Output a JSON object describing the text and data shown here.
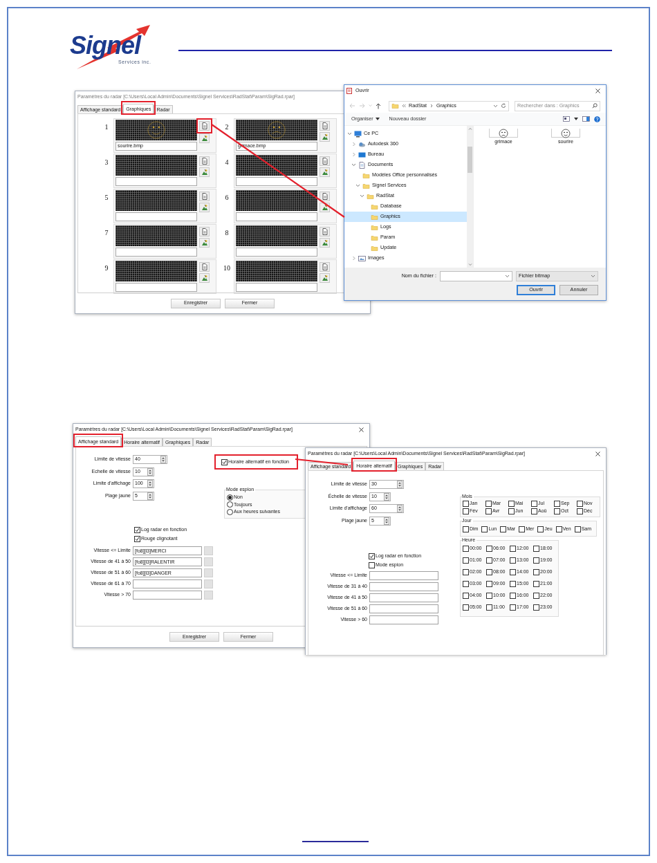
{
  "header": {
    "logo_name": "Signel",
    "logo_tagline": "Services inc."
  },
  "graphics_dialog": {
    "title": "Paramètres du radar [C:\\Users\\Local Admin\\Documents\\Signel Services\\RadStat\\Param\\SigRad.rpar]",
    "tabs": [
      {
        "label": "Affichage standard",
        "selected": false,
        "highlighted": false
      },
      {
        "label": "Graphiques",
        "selected": true,
        "highlighted": true
      },
      {
        "label": "Radar",
        "selected": false,
        "highlighted": false
      }
    ],
    "slots": [
      {
        "number": "1",
        "file": "sourire.bmp",
        "kind": "smile",
        "load_highlighted": true
      },
      {
        "number": "2",
        "file": "grimace.bmp",
        "kind": "grimace",
        "load_highlighted": false
      },
      {
        "number": "3",
        "kind": "empty",
        "load_highlighted": false
      },
      {
        "number": "4",
        "kind": "empty",
        "load_highlighted": false
      },
      {
        "number": "5",
        "kind": "empty",
        "load_highlighted": false
      },
      {
        "number": "6",
        "kind": "empty",
        "load_highlighted": false
      },
      {
        "number": "7",
        "kind": "empty",
        "load_highlighted": false
      },
      {
        "number": "8",
        "kind": "empty",
        "load_highlighted": false
      },
      {
        "number": "9",
        "kind": "empty",
        "load_highlighted": false
      },
      {
        "number": "10",
        "kind": "empty",
        "load_highlighted": false
      }
    ],
    "buttons": [
      "Enregistrer",
      "Fermer"
    ]
  },
  "open_dialog": {
    "title": "Ouvrir",
    "path": [
      "RadStat",
      "Graphics"
    ],
    "search_placeholder": "Rechercher dans : Graphics",
    "toolbar": [
      {
        "label": "Organiser",
        "kind": "menu"
      },
      {
        "label": "Nouveau dossier",
        "kind": "button"
      }
    ],
    "tree": [
      {
        "label": "Ce PC",
        "kind": "computer",
        "expanded": true,
        "selected": false,
        "children": [
          {
            "label": "Autodesk 360",
            "kind": "cloud",
            "expanded": false,
            "selected": false
          },
          {
            "label": "Bureau",
            "kind": "desktop",
            "expanded": false,
            "selected": false
          },
          {
            "label": "Documents",
            "kind": "documents",
            "expanded": true,
            "selected": false,
            "children": [
              {
                "label": "Modèles Office personnalisés",
                "kind": "folder",
                "selected": false
              },
              {
                "label": "Signel Services",
                "kind": "folder",
                "expanded": true,
                "selected": false,
                "children": [
                  {
                    "label": "RadStat",
                    "kind": "folder",
                    "expanded": true,
                    "selected": false,
                    "children": [
                      {
                        "label": "Database",
                        "kind": "folder",
                        "selected": false
                      },
                      {
                        "label": "Graphics",
                        "kind": "folder",
                        "selected": true
                      },
                      {
                        "label": "Logs",
                        "kind": "folder",
                        "selected": false
                      },
                      {
                        "label": "Param",
                        "kind": "folder",
                        "selected": false
                      },
                      {
                        "label": "Update",
                        "kind": "folder",
                        "selected": false
                      }
                    ]
                  }
                ]
              }
            ]
          },
          {
            "label": "Images",
            "kind": "images",
            "expanded": false,
            "selected": false
          }
        ]
      }
    ],
    "files": [
      {
        "name": "grimace",
        "kind": "frown"
      },
      {
        "name": "sourire",
        "kind": "smile"
      }
    ],
    "filename_label": "Nom du fichier :",
    "filetype": "Fichier bitmap",
    "buttons": [
      {
        "label": "Ouvrir",
        "default": true
      },
      {
        "label": "Annuler",
        "default": false
      }
    ]
  },
  "standard_dialog": {
    "title": "Paramètres du radar [C:\\Users\\Local Admin\\Documents\\Signel Services\\RadStat\\Param\\SigRad.rpar]",
    "tabs": [
      {
        "label": "Affichage standard",
        "selected": true,
        "highlighted": true
      },
      {
        "label": "Horaire alternatif",
        "selected": false,
        "highlighted": false
      },
      {
        "label": "Graphiques",
        "selected": false,
        "highlighted": false
      },
      {
        "label": "Radar",
        "selected": false,
        "highlighted": false
      }
    ],
    "spinners": [
      {
        "label": "Limite de vitesse",
        "value": "40"
      },
      {
        "label": "Echelle de vitesse",
        "value": "10"
      },
      {
        "label": "Limite d'affichage",
        "value": "100"
      },
      {
        "label": "Plage jaune",
        "value": "5"
      }
    ],
    "alternate_schedule": {
      "label": "Horaire alternatif en fonction",
      "checked": true,
      "highlighted": true
    },
    "spy_mode": {
      "title": "Mode espion",
      "options": [
        {
          "label": "Non",
          "selected": true
        },
        {
          "label": "Toujours",
          "selected": false
        },
        {
          "label": "Aux heures suivantes",
          "selected": false
        }
      ]
    },
    "options": [
      {
        "label": "Log radar en fonction",
        "checked": true
      },
      {
        "label": "Rouge clignotant",
        "checked": true
      }
    ],
    "messages": [
      {
        "label": "Vitesse <= Limite",
        "value": "[fo8][l3]MERCI"
      },
      {
        "label": "Vitesse de 41 à 50",
        "value": "[fo8][l3]RALENTIR"
      },
      {
        "label": "Vitesse de 51 à 60",
        "value": "[fo8][l3]DANGER"
      },
      {
        "label": "Vitesse de 61 à 70"
      },
      {
        "label": "Vitesse > 70"
      }
    ],
    "buttons": [
      "Enregistrer",
      "Fermer"
    ]
  },
  "alternate_dialog": {
    "title": "Paramètres du radar [C:\\Users\\Local Admin\\Documents\\Signel Services\\RadStat\\Param\\SigRad.rpar]",
    "tabs": [
      {
        "label": "Affichage standard",
        "selected": false,
        "highlighted": false
      },
      {
        "label": "Horaire alternatif",
        "selected": true,
        "highlighted": true
      },
      {
        "label": "Graphiques",
        "selected": false,
        "highlighted": false
      },
      {
        "label": "Radar",
        "selected": false,
        "highlighted": false
      }
    ],
    "spinners": [
      {
        "label": "Limite de vitesse",
        "value": "30"
      },
      {
        "label": "Échelle de vitesse",
        "value": "10"
      },
      {
        "label": "Limite d'affichage",
        "value": "60"
      },
      {
        "label": "Plage jaune",
        "value": "5"
      }
    ],
    "options": [
      {
        "label": "Log radar en fonction",
        "checked": true
      },
      {
        "label": "Mode espion",
        "checked": false
      }
    ],
    "messages": [
      {
        "label": "Vitesse <= Limite"
      },
      {
        "label": "Vitesse de 31 à 40"
      },
      {
        "label": "Vitesse de 41 à 50"
      },
      {
        "label": "Vitesse de 51 à 60"
      },
      {
        "label": "Vitesse > 60"
      }
    ],
    "months": {
      "title": "Mois",
      "items": [
        {
          "label": "Jan",
          "checked": false
        },
        {
          "label": "Fév",
          "checked": false
        },
        {
          "label": "Mar",
          "checked": false
        },
        {
          "label": "Avr",
          "checked": false
        },
        {
          "label": "Mai",
          "checked": false
        },
        {
          "label": "Jun",
          "checked": false
        },
        {
          "label": "Jul",
          "checked": false
        },
        {
          "label": "Aoû",
          "checked": false
        },
        {
          "label": "Sep",
          "checked": false
        },
        {
          "label": "Oct",
          "checked": false
        },
        {
          "label": "Nov",
          "checked": false
        },
        {
          "label": "Déc",
          "checked": false
        }
      ]
    },
    "days": {
      "title": "Jour",
      "items": [
        {
          "label": "Dim",
          "checked": false
        },
        {
          "label": "Lun",
          "checked": false
        },
        {
          "label": "Mar",
          "checked": false
        },
        {
          "label": "Mer",
          "checked": false
        },
        {
          "label": "Jeu",
          "checked": false
        },
        {
          "label": "Ven",
          "checked": false
        },
        {
          "label": "Sam",
          "checked": false
        }
      ]
    },
    "hours": {
      "title": "Heure",
      "items": [
        {
          "label": "00:00",
          "checked": false
        },
        {
          "label": "01:00",
          "checked": false
        },
        {
          "label": "02:00",
          "checked": false
        },
        {
          "label": "03:00",
          "checked": false
        },
        {
          "label": "04:00",
          "checked": false
        },
        {
          "label": "05:00",
          "checked": false
        },
        {
          "label": "06:00",
          "checked": false
        },
        {
          "label": "07:00",
          "checked": false
        },
        {
          "label": "08:00",
          "checked": false
        },
        {
          "label": "09:00",
          "checked": false
        },
        {
          "label": "10:00",
          "checked": false
        },
        {
          "label": "11:00",
          "checked": false
        },
        {
          "label": "12:00",
          "checked": false
        },
        {
          "label": "13:00",
          "checked": false
        },
        {
          "label": "14:00",
          "checked": false
        },
        {
          "label": "15:00",
          "checked": false
        },
        {
          "label": "16:00",
          "checked": false
        },
        {
          "label": "17:00",
          "checked": false
        },
        {
          "label": "18:00",
          "checked": false
        },
        {
          "label": "19:00",
          "checked": false
        },
        {
          "label": "20:00",
          "checked": false
        },
        {
          "label": "21:00",
          "checked": false
        },
        {
          "label": "22:00",
          "checked": false
        },
        {
          "label": "23:00",
          "checked": false
        }
      ]
    }
  }
}
